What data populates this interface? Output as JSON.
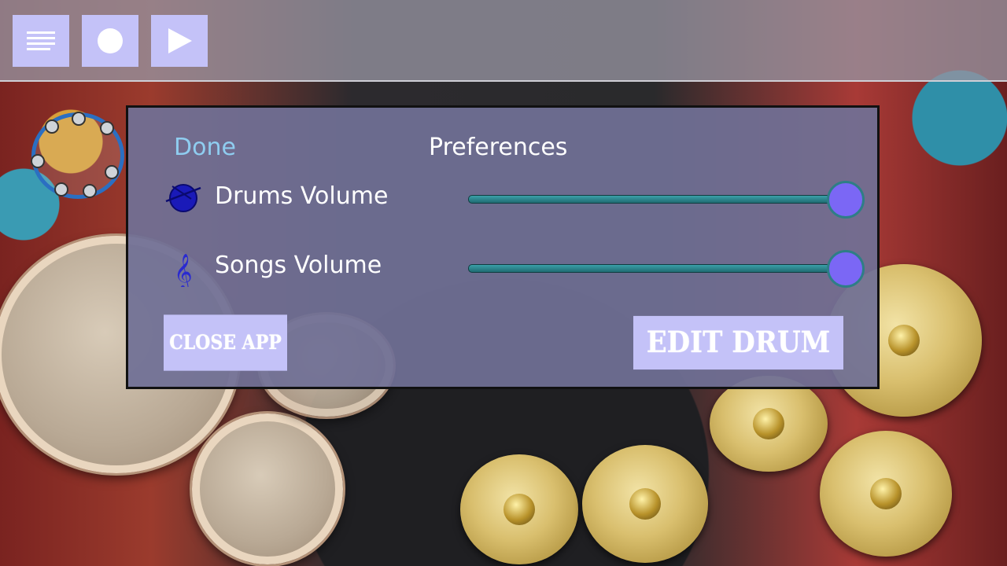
{
  "toolbar": {
    "buttons": [
      {
        "name": "menu",
        "icon": "list-icon"
      },
      {
        "name": "record",
        "icon": "record-icon"
      },
      {
        "name": "play",
        "icon": "play-icon"
      }
    ]
  },
  "dialog": {
    "done_label": "Done",
    "title": "Preferences",
    "rows": [
      {
        "label": "Drums Volume",
        "icon": "drum-icon",
        "value": 1.0
      },
      {
        "label": "Songs Volume",
        "icon": "treble-clef-icon",
        "value": 1.0
      }
    ],
    "close_app_label": "CLOSE APP",
    "edit_drum_label": "EDIT DRUM"
  },
  "colors": {
    "accent_button": "#c4c2f8",
    "done_text": "#8fcdf0",
    "slider_thumb": "#7b67f5",
    "slider_track": "#2f8e96"
  }
}
